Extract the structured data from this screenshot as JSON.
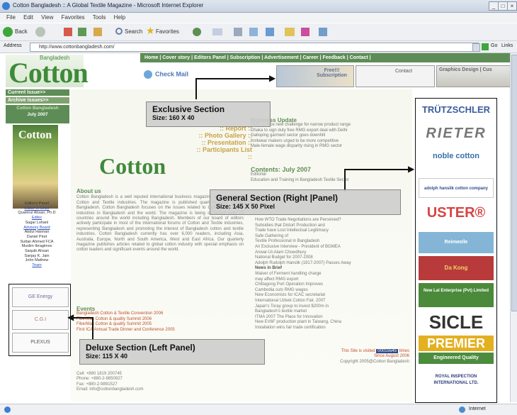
{
  "window": {
    "title": "Cotton Bangladesh :: A Global Textile Magazine - Microsoft Internet Explorer",
    "controls": [
      "_",
      "□",
      "×"
    ]
  },
  "menu": [
    "File",
    "Edit",
    "View",
    "Favorites",
    "Tools",
    "Help"
  ],
  "toolbar": {
    "back": "Back",
    "search": "Search",
    "favorites": "Favorites",
    "go": "Go",
    "links": "Links"
  },
  "address": {
    "label": "Address",
    "url": "http://www.cottonbangladesh.com/"
  },
  "site": {
    "nav": "Home | Cover story | Editors Panel | Subscription | Advertisement | Career | Feedback | Contact |",
    "logo_text": "Cotton",
    "logo_small": "Bangladesh",
    "check_mail": "Check Mail",
    "top_ads": {
      "subscription": "Free!!! Subscription",
      "contact": "Contact",
      "graphics": "Graphics Design | Cus"
    },
    "left": {
      "current_issue": "Current Issue>>",
      "archive": "Archive Issues>>",
      "mag_title": "Cotton Bangladesh",
      "mag_date": "July 2007",
      "cover_logo": "Cotton",
      "staff": [
        "Editor's Panel",
        "Editor-in-Chief",
        "Quamrul Ahsan, Ph.D",
        "Editor",
        "Sagar Lohani",
        "Advisory Board",
        "Abdul Hannan",
        "Daniel Piret",
        "Sultan Ahmed FCA",
        "Muslim Ibragimov",
        "Saquib Ahsan",
        "Sanjay K. Jain",
        "John Mathew",
        "Team"
      ],
      "deluxe_logos": [
        "GE Energy",
        "C.G.I",
        "PLEXUS"
      ]
    },
    "center": {
      "links": [
        ":: Report ::",
        ":: Photo Gallery ::",
        ":: Presentation ::",
        ":: Participants List ::"
      ],
      "business_update": "Business Update",
      "biz_items": [
        "RMG to face new challenge for narrow product range",
        "Dhaka to sign duty free RMG export deal with Delhi",
        "Galloping garment sector goes downhill",
        "Knitwear makers urged to be more competitive",
        "Male-female wage disparity rising in RMG sector"
      ],
      "contents_heading": "Contents: July 2007",
      "contents_items": [
        "Editorial",
        "Education and Training in Bangladesh Textile Sector"
      ],
      "contents_more": [
        "How WTO Trade Negotiations are Perceived?",
        "Subsidies that Distort Production and",
        "Trade have Lost Intellectual Legitimacy",
        "Safe Gathering of",
        "Textile Professional in Bangladesh",
        "An Exclusive Interview - President of BGMEA",
        "Anwar-Ul-Alam Chowdhury",
        "National Budget for 2007-2008",
        "Adolph Rudolph Hanslik (1917-2007) Passes Away",
        "News in Brief",
        "Waiver of Ferment handling charge",
        "may affect RMG export",
        "Chittagong Port Operation Improves",
        "Cambodia cuts RMG wages",
        "New Economists for ICAC secretariat",
        "International Uzbek Cotton Fair, 2007",
        "Japan's Toray group to invest $200m in",
        "Bangladesh's textile market",
        "ITMA 2007 The Place for Innovation",
        "New EV6F production plant in Taiwang, China",
        "Installation wins fair trade certification"
      ],
      "about_heading": "About us",
      "about_text": "Cotton Bangladesh is a well reputed international business magazine associated with Cotton and Textile industries. The magazine is published quarterly from Dhaka Bangladesh. Cotton Bangladesh focuses on the issues related to Cotton and Textile industries in Bangladesh and the world. The magazine is being circulated over 70 countries around the world including Bangladesh. Members of our board of editors actively participate in most of the international forums of Cotton and Textile industries, representing Bangladesh and promoting the interest of Bangladesh cotton and textile industries. Cotton Bangladesh currently has over 6,000 readers, including Asia, Australia, Europe, North and South America, West and East Africa. Our quarterly magazine publishes articles related to global cotton industry with special emphasis on cotton leaders and significant events around the world.",
      "events_heading": "Events",
      "events": [
        "Bangladesh Cotton & Textile Convention 2006",
        "FiberMax Cotton & quality Summit 2006",
        "FiberMax Cotton & quality Summit 2005",
        "First ICA Annual Trade Dinner and Conference 2005"
      ],
      "contact": [
        "Cell: +880 1819 200745",
        "Phone: +880-2-9850927",
        "Fax: +880-2-9891527",
        "Email: info@cottonbangladesh.com"
      ],
      "visitor_prefix": "This Site is visited",
      "visitor_count": "00015545",
      "visitor_suffix": "times",
      "since": "Since August 2006",
      "copyright": "Copyright 2005@Cotton Bangladesh"
    },
    "right_logos": [
      "TRÜTZSCHLER",
      "RIETER",
      "noble cotton",
      "adolph hanslik cotton company",
      "USTER®",
      "Reinwolle",
      "Da Kong",
      "New Lal Enterprise (Pvt) Limited",
      "SICLE",
      "PREMIER",
      "Engineered Quality",
      "ROYAL INSPECTION INTERNATIONAL LTD."
    ]
  },
  "callouts": {
    "exclusive_title": "Exclusive Section",
    "exclusive_size": "Size: 160 X 40",
    "general_title": "General Section (Right |Panel)",
    "general_size": "Size: 145 X 50 Pixel",
    "deluxe_title": "Deluxe Section (Left Panel)",
    "deluxe_size": "Size: 115 X 40"
  },
  "status": {
    "zone": "Internet"
  }
}
